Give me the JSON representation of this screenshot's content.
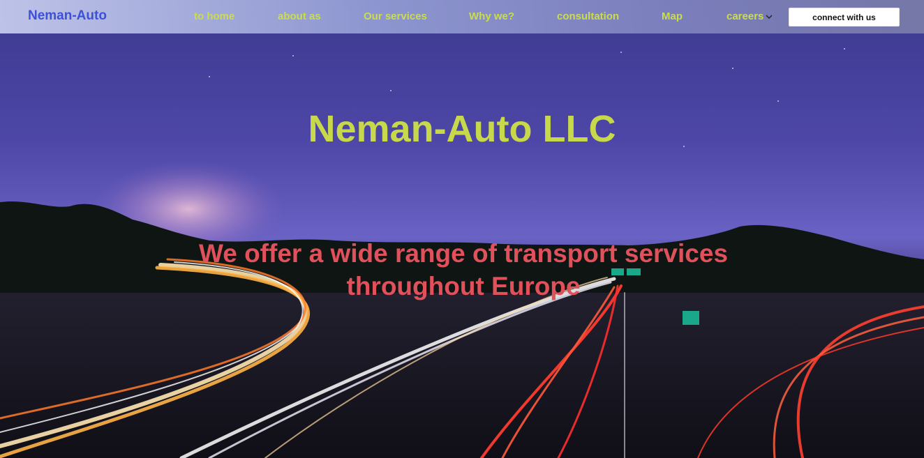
{
  "nav": {
    "brand": "Neman-Auto",
    "links": [
      {
        "label": "to home"
      },
      {
        "label": "about as"
      },
      {
        "label": "Our services"
      },
      {
        "label": "Why we?"
      },
      {
        "label": "consultation"
      },
      {
        "label": "Map"
      },
      {
        "label": "careers"
      }
    ],
    "cta_label": "connect with us"
  },
  "hero": {
    "title": "Neman-Auto LLC",
    "subtitle": "We offer a wide range of transport services throughout Europe"
  },
  "colors": {
    "brand": "#3d51d6",
    "nav_link": "#c9de4a",
    "title": "#c7d94b",
    "subtitle": "#e0515c"
  }
}
